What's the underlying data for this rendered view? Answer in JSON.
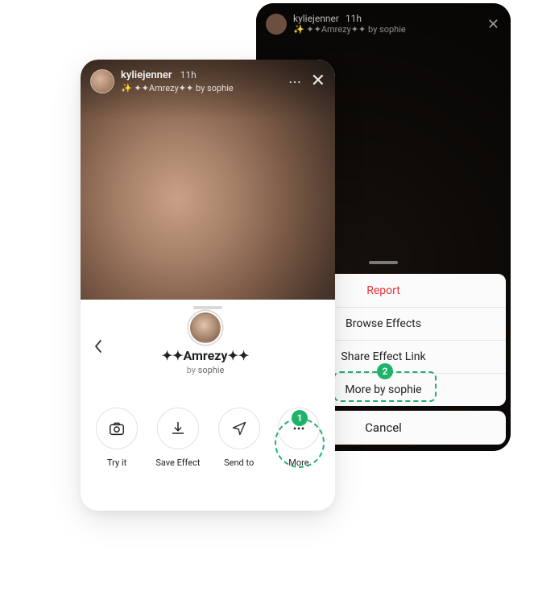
{
  "back": {
    "username": "kyliejenner",
    "time": "11h",
    "effect_line": "✨ ✦✦Amrezy✦✦ by sophie"
  },
  "sheet": {
    "report": "Report",
    "browse_effects": "Browse Effects",
    "share_effect_link": "Share Effect Link",
    "more_by": "More by sophie",
    "cancel": "Cancel"
  },
  "front": {
    "username": "kyliejenner",
    "time": "11h",
    "effect_line": "✨ ✦✦Amrezy✦✦ by sophie",
    "effect_name": "✦✦Amrezy✦✦",
    "by_prefix": "by ",
    "creator": "sophie",
    "actions": {
      "try_it": "Try it",
      "save_effect": "Save Effect",
      "send_to": "Send to",
      "more": "More"
    }
  },
  "steps": {
    "one": "1",
    "two": "2"
  }
}
